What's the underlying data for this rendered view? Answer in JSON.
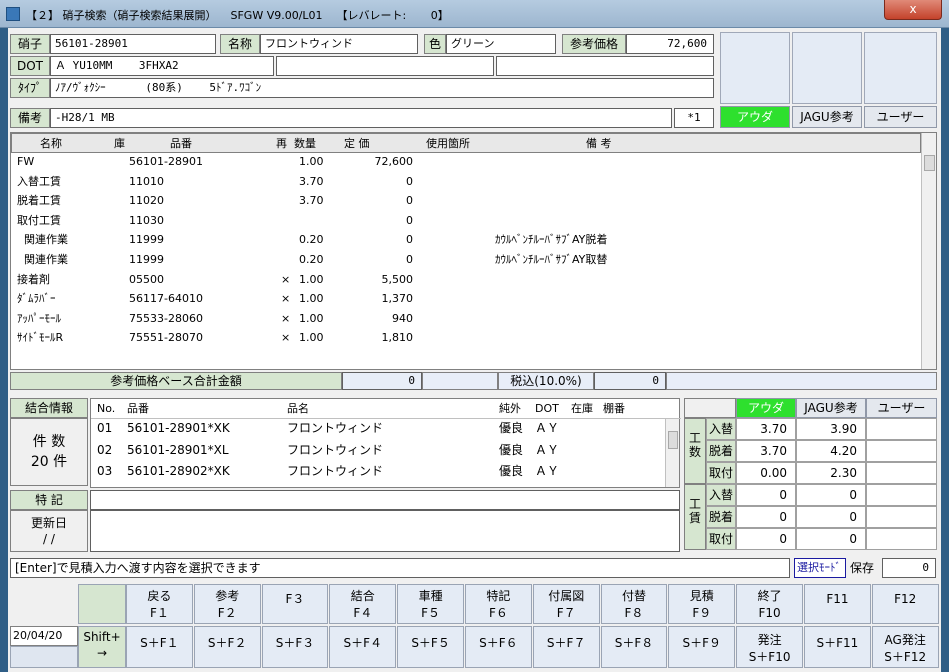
{
  "window": {
    "title": "【２】 硝子検索（硝子検索結果展開）    SFGW V9.00/L01    【レバレート:       0】",
    "close": "x"
  },
  "header": {
    "glass_label": "硝子",
    "glass_no": "56101-28901",
    "name_label": "名称",
    "name_value": "フロントウィンド",
    "color_label": "色",
    "color_value": "グリーン",
    "refprice_label": "参考価格",
    "refprice_value": "72,600",
    "dot_label": "DOT",
    "dot_value": "Ａ YU10MM    3FHXA2",
    "type_label": "ﾀｲﾌﾟ",
    "type_value": "ﾉｱ/ｳﾞｫｸｼｰ      (80系)    5ﾄﾞｱ.ﾜｺﾞﾝ",
    "note_label": "備考",
    "note_value": "-H28/1 MB",
    "star": "*1",
    "btn_outa": "アウダ",
    "btn_jagu": "JAGU参考",
    "btn_user": "ユーザー"
  },
  "parts": {
    "columns": [
      "名称",
      "庫",
      "品番",
      "再",
      "数量",
      "定 価",
      "使用箇所",
      "備 考"
    ],
    "rows": [
      {
        "name": "FW",
        "ko": "",
        "no": "56101-28901",
        "re": "",
        "qty": "1.00",
        "price": "72,600",
        "use": "",
        "note": ""
      },
      {
        "name": "入替工賃",
        "ko": "",
        "no": "11010",
        "re": "",
        "qty": "3.70",
        "price": "0",
        "use": "",
        "note": ""
      },
      {
        "name": "脱着工賃",
        "ko": "",
        "no": "11020",
        "re": "",
        "qty": "3.70",
        "price": "0",
        "use": "",
        "note": ""
      },
      {
        "name": "取付工賃",
        "ko": "",
        "no": "11030",
        "re": "",
        "qty": "",
        "price": "0",
        "use": "",
        "note": ""
      },
      {
        "name": "  関連作業",
        "ko": "",
        "no": "11999",
        "re": "",
        "qty": "0.20",
        "price": "0",
        "use": "",
        "note": "ｶｳﾙﾍﾞﾝﾁﾙｰﾊﾞｻﾌﾞAY脱着"
      },
      {
        "name": "  関連作業",
        "ko": "",
        "no": "11999",
        "re": "",
        "qty": "0.20",
        "price": "0",
        "use": "",
        "note": "ｶｳﾙﾍﾞﾝﾁﾙｰﾊﾞｻﾌﾞAY取替"
      },
      {
        "name": "接着剤",
        "ko": "",
        "no": "05500",
        "re": "×",
        "qty": "1.00",
        "price": "5,500",
        "use": "",
        "note": ""
      },
      {
        "name": "ﾀﾞﾑﾗﾊﾞｰ",
        "ko": "",
        "no": "56117-64010",
        "re": "×",
        "qty": "1.00",
        "price": "1,370",
        "use": "",
        "note": ""
      },
      {
        "name": "ｱｯﾊﾟｰﾓｰﾙ",
        "ko": "",
        "no": "75533-28060",
        "re": "×",
        "qty": "1.00",
        "price": "940",
        "use": "",
        "note": ""
      },
      {
        "name": "ｻｲﾄﾞﾓｰﾙR",
        "ko": "",
        "no": "75551-28070",
        "re": "×",
        "qty": "1.00",
        "price": "1,810",
        "use": "",
        "note": ""
      }
    ],
    "total_label": "参考価格ベース合計金額",
    "total_value": "0",
    "tax_label": "税込(10.0%)",
    "tax_value": "0"
  },
  "binding": {
    "label": "結合情報",
    "count_label": "件 数",
    "count_value": "20 件",
    "columns": [
      "No.",
      "品番",
      "品名",
      "純外",
      "DOT",
      "在庫",
      "棚番"
    ],
    "rows": [
      {
        "no": "01",
        "part": "56101-28901*XK",
        "name": "フロントウィンド",
        "kind": "優良",
        "dot": "ＡＹ"
      },
      {
        "no": "02",
        "part": "56101-28901*XL",
        "name": "フロントウィンド",
        "kind": "優良",
        "dot": "ＡＹ"
      },
      {
        "no": "03",
        "part": "56101-28902*XK",
        "name": "フロントウィンド",
        "kind": "優良",
        "dot": "ＡＹ"
      }
    ],
    "special_label": "特 記",
    "updated_label": "更新日",
    "updated_value": "/ /"
  },
  "labor": {
    "columns": [
      "アウダ",
      "JAGU参考",
      "ユーザー"
    ],
    "man_label": "工数",
    "cost_label": "工賃",
    "man_rows": [
      {
        "label": "入替",
        "a": "3.70",
        "j": "3.90",
        "u": ""
      },
      {
        "label": "脱着",
        "a": "3.70",
        "j": "4.20",
        "u": ""
      },
      {
        "label": "取付",
        "a": "0.00",
        "j": "2.30",
        "u": ""
      }
    ],
    "cost_rows": [
      {
        "label": "入替",
        "a": "0",
        "j": "0",
        "u": ""
      },
      {
        "label": "脱着",
        "a": "0",
        "j": "0",
        "u": ""
      },
      {
        "label": "取付",
        "a": "0",
        "j": "0",
        "u": ""
      }
    ]
  },
  "status": {
    "message": "[Enter]で見積入力へ渡す内容を選択できます",
    "mode": "選択ﾓｰﾄﾞ",
    "save_label": "保存",
    "save_value": "0"
  },
  "footer": {
    "date": "20/04/20",
    "shift": "Shift+",
    "arrow": "→",
    "fkeys": [
      {
        "top": "戻る",
        "bottom": "F１"
      },
      {
        "top": "参考",
        "bottom": "F２"
      },
      {
        "top": "",
        "bottom": "F３"
      },
      {
        "top": "結合",
        "bottom": "F４"
      },
      {
        "top": "車種",
        "bottom": "F５"
      },
      {
        "top": "特記",
        "bottom": "F６"
      },
      {
        "top": "付属図",
        "bottom": "F７"
      },
      {
        "top": "付替",
        "bottom": "F８"
      },
      {
        "top": "見積",
        "bottom": "F９"
      },
      {
        "top": "終了",
        "bottom": "F10"
      },
      {
        "top": "",
        "bottom": "F11"
      },
      {
        "top": "",
        "bottom": "F12"
      }
    ],
    "skeys": [
      {
        "top": "",
        "bottom": "S＋F１"
      },
      {
        "top": "",
        "bottom": "S＋F２"
      },
      {
        "top": "",
        "bottom": "S＋F３"
      },
      {
        "top": "",
        "bottom": "S＋F４"
      },
      {
        "top": "",
        "bottom": "S＋F５"
      },
      {
        "top": "",
        "bottom": "S＋F６"
      },
      {
        "top": "",
        "bottom": "S＋F７"
      },
      {
        "top": "",
        "bottom": "S＋F８"
      },
      {
        "top": "",
        "bottom": "S＋F９"
      },
      {
        "top": "発注",
        "bottom": "S＋F10"
      },
      {
        "top": "",
        "bottom": "S＋F11"
      },
      {
        "top": "AG発注",
        "bottom": "S＋F12"
      }
    ]
  },
  "colors": {
    "accent_green": "#2ee02e",
    "label_green": "#d6e6d0",
    "tile": "#e4ebf5"
  }
}
